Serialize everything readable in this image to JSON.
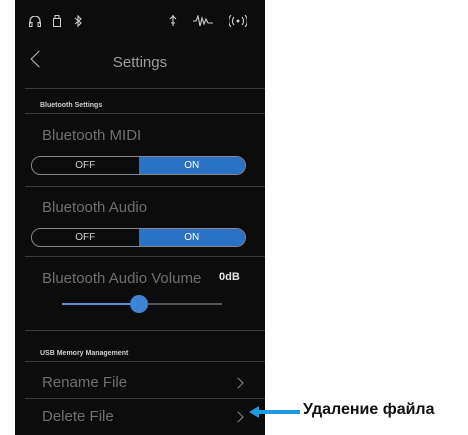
{
  "status_icons": [
    "headphones-icon",
    "usb-stick-icon",
    "bluetooth-icon",
    "microphone-icon",
    "line-in-icon",
    "wireless-icon"
  ],
  "header": {
    "title": "Settings"
  },
  "bluetooth": {
    "section_label": "Bluetooth Settings",
    "midi_label": "Bluetooth MIDI",
    "midi_off": "OFF",
    "midi_on": "ON",
    "audio_label": "Bluetooth Audio",
    "audio_off": "OFF",
    "audio_on": "ON",
    "volume_label": "Bluetooth Audio Volume",
    "volume_value": "0dB",
    "volume_level": 0.48
  },
  "usb": {
    "section_label": "USB Memory Management",
    "rename_label": "Rename File",
    "delete_label": "Delete File"
  },
  "callout": {
    "text": "Удаление файла",
    "color": "#1e9be0"
  },
  "colors": {
    "accent": "#2a72c6",
    "panel": "#0c0c0c"
  }
}
